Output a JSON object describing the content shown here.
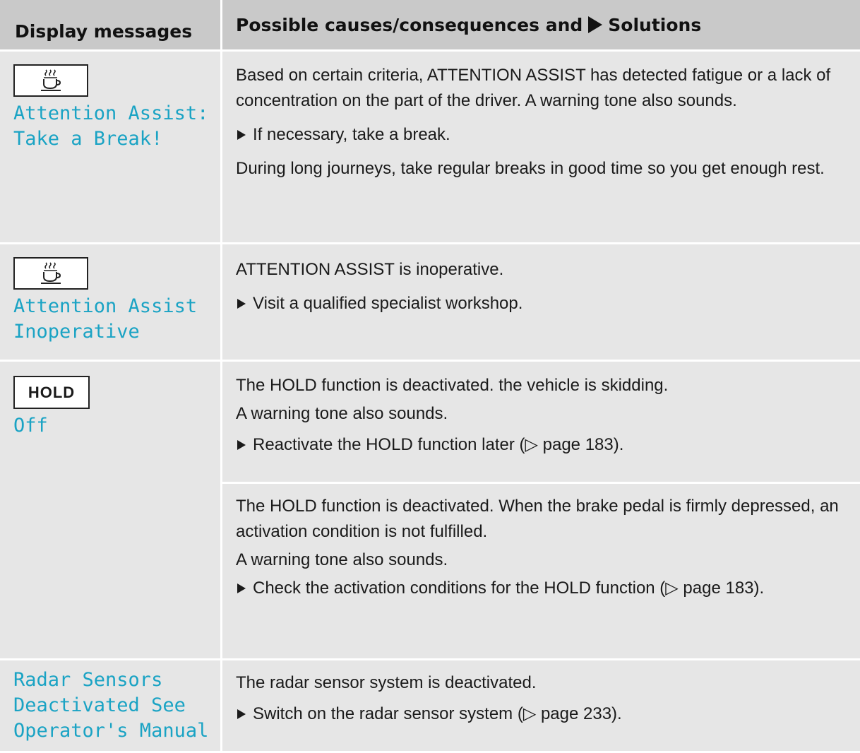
{
  "header": {
    "col1": "Display messages",
    "col2_before": "Possible causes/consequences and",
    "col2_after": "Solutions"
  },
  "rows": [
    {
      "icon": "coffee-cup-icon",
      "message": "Attention Assist:\nTake a Break!",
      "paragraphs": [
        "Based on certain criteria, ATTENTION ASSIST has detected fatigue or a lack of concentration on the part of the driver. A warning tone also sounds.",
        "If necessary, take a break.",
        "During long journeys, take regular breaks in good time so you get enough rest."
      ]
    },
    {
      "icon": "coffee-cup-icon",
      "message": "Attention Assist\nInoperative",
      "paragraphs": [
        "ATTENTION ASSIST is inoperative.",
        "Visit a qualified specialist workshop."
      ]
    },
    {
      "icon_text": "HOLD",
      "message": "Off",
      "seg1": [
        "The HOLD function is deactivated. the vehicle is skidding.",
        "A warning tone also sounds.",
        "Reactivate the HOLD function later (",
        "▷ page 183).",
        ""
      ],
      "seg2": [
        "The HOLD function is deactivated. When the brake pedal is firmly depressed, an activation condition is not fulfilled.",
        "A warning tone also sounds.",
        "Check the activation conditions for the HOLD function (",
        "▷ page 183)."
      ]
    },
    {
      "message": "Radar Sensors\nDeactivated See\nOperator's Manual",
      "paragraphs": [
        "The radar sensor system is deactivated.",
        "Switch on the radar sensor system (",
        "▷ page 233)."
      ]
    }
  ]
}
